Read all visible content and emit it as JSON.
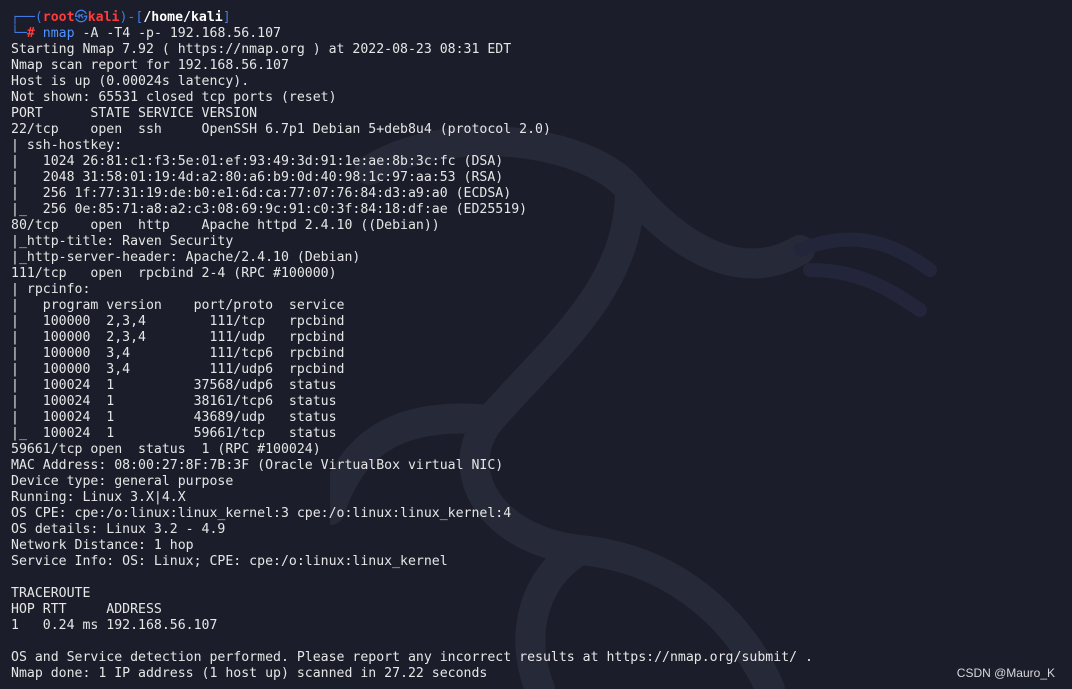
{
  "prompt": {
    "frame_open": "┌──(",
    "user": "root",
    "at": "㉿",
    "host": "kali",
    "frame_mid": ")-[",
    "path": "/home/kali",
    "frame_close": "]",
    "frame_bottom": "└─",
    "symbol": "#",
    "command": "nmap",
    "args": " -A -T4 -p- 192.168.56.107"
  },
  "output_lines": [
    "Starting Nmap 7.92 ( https://nmap.org ) at 2022-08-23 08:31 EDT",
    "Nmap scan report for 192.168.56.107",
    "Host is up (0.00024s latency).",
    "Not shown: 65531 closed tcp ports (reset)",
    "PORT      STATE SERVICE VERSION",
    "22/tcp    open  ssh     OpenSSH 6.7p1 Debian 5+deb8u4 (protocol 2.0)",
    "| ssh-hostkey:",
    "|   1024 26:81:c1:f3:5e:01:ef:93:49:3d:91:1e:ae:8b:3c:fc (DSA)",
    "|   2048 31:58:01:19:4d:a2:80:a6:b9:0d:40:98:1c:97:aa:53 (RSA)",
    "|   256 1f:77:31:19:de:b0:e1:6d:ca:77:07:76:84:d3:a9:a0 (ECDSA)",
    "|_  256 0e:85:71:a8:a2:c3:08:69:9c:91:c0:3f:84:18:df:ae (ED25519)",
    "80/tcp    open  http    Apache httpd 2.4.10 ((Debian))",
    "|_http-title: Raven Security",
    "|_http-server-header: Apache/2.4.10 (Debian)",
    "111/tcp   open  rpcbind 2-4 (RPC #100000)",
    "| rpcinfo:",
    "|   program version    port/proto  service",
    "|   100000  2,3,4        111/tcp   rpcbind",
    "|   100000  2,3,4        111/udp   rpcbind",
    "|   100000  3,4          111/tcp6  rpcbind",
    "|   100000  3,4          111/udp6  rpcbind",
    "|   100024  1          37568/udp6  status",
    "|   100024  1          38161/tcp6  status",
    "|   100024  1          43689/udp   status",
    "|_  100024  1          59661/tcp   status",
    "59661/tcp open  status  1 (RPC #100024)",
    "MAC Address: 08:00:27:8F:7B:3F (Oracle VirtualBox virtual NIC)",
    "Device type: general purpose",
    "Running: Linux 3.X|4.X",
    "OS CPE: cpe:/o:linux:linux_kernel:3 cpe:/o:linux:linux_kernel:4",
    "OS details: Linux 3.2 - 4.9",
    "Network Distance: 1 hop",
    "Service Info: OS: Linux; CPE: cpe:/o:linux:linux_kernel",
    "",
    "TRACEROUTE",
    "HOP RTT     ADDRESS",
    "1   0.24 ms 192.168.56.107",
    "",
    "OS and Service detection performed. Please report any incorrect results at https://nmap.org/submit/ .",
    "Nmap done: 1 IP address (1 host up) scanned in 27.22 seconds"
  ],
  "watermark": "CSDN @Mauro_K",
  "icons": {
    "background_logo": "kali-dragon-icon"
  },
  "colors": {
    "background": "#1b1d2a",
    "frame": "#3f7be0",
    "user_host": "#ff3a3a",
    "command": "#4e93ff",
    "text": "#e6e6e6"
  }
}
